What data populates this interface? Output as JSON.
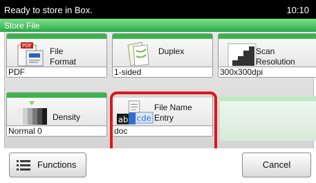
{
  "status": {
    "message": "Ready to store in Box.",
    "time": "10:10"
  },
  "title": "Store File",
  "tiles": [
    {
      "label_line1": "File",
      "label_line2": "Format",
      "value": "PDF",
      "icon": "pdf-file-format-icon"
    },
    {
      "label_line1": "Duplex",
      "label_line2": "",
      "value": "1-sided",
      "icon": "duplex-pages-icon"
    },
    {
      "label_line1": "Scan",
      "label_line2": "Resolution",
      "value": "300x300dpi",
      "icon": "scan-resolution-icon"
    },
    {
      "label_line1": "Density",
      "label_line2": "",
      "value": "Normal 0",
      "icon": "density-gradient-icon"
    },
    {
      "label_line1": "File Name",
      "label_line2": "Entry",
      "value": "doc",
      "icon": "file-name-entry-icon"
    }
  ],
  "buttons": {
    "functions": "Functions",
    "cancel": "Cancel"
  },
  "colors": {
    "accent_green": "#3cb34a",
    "highlight_red": "#e0151b",
    "status_bg": "#000000"
  }
}
